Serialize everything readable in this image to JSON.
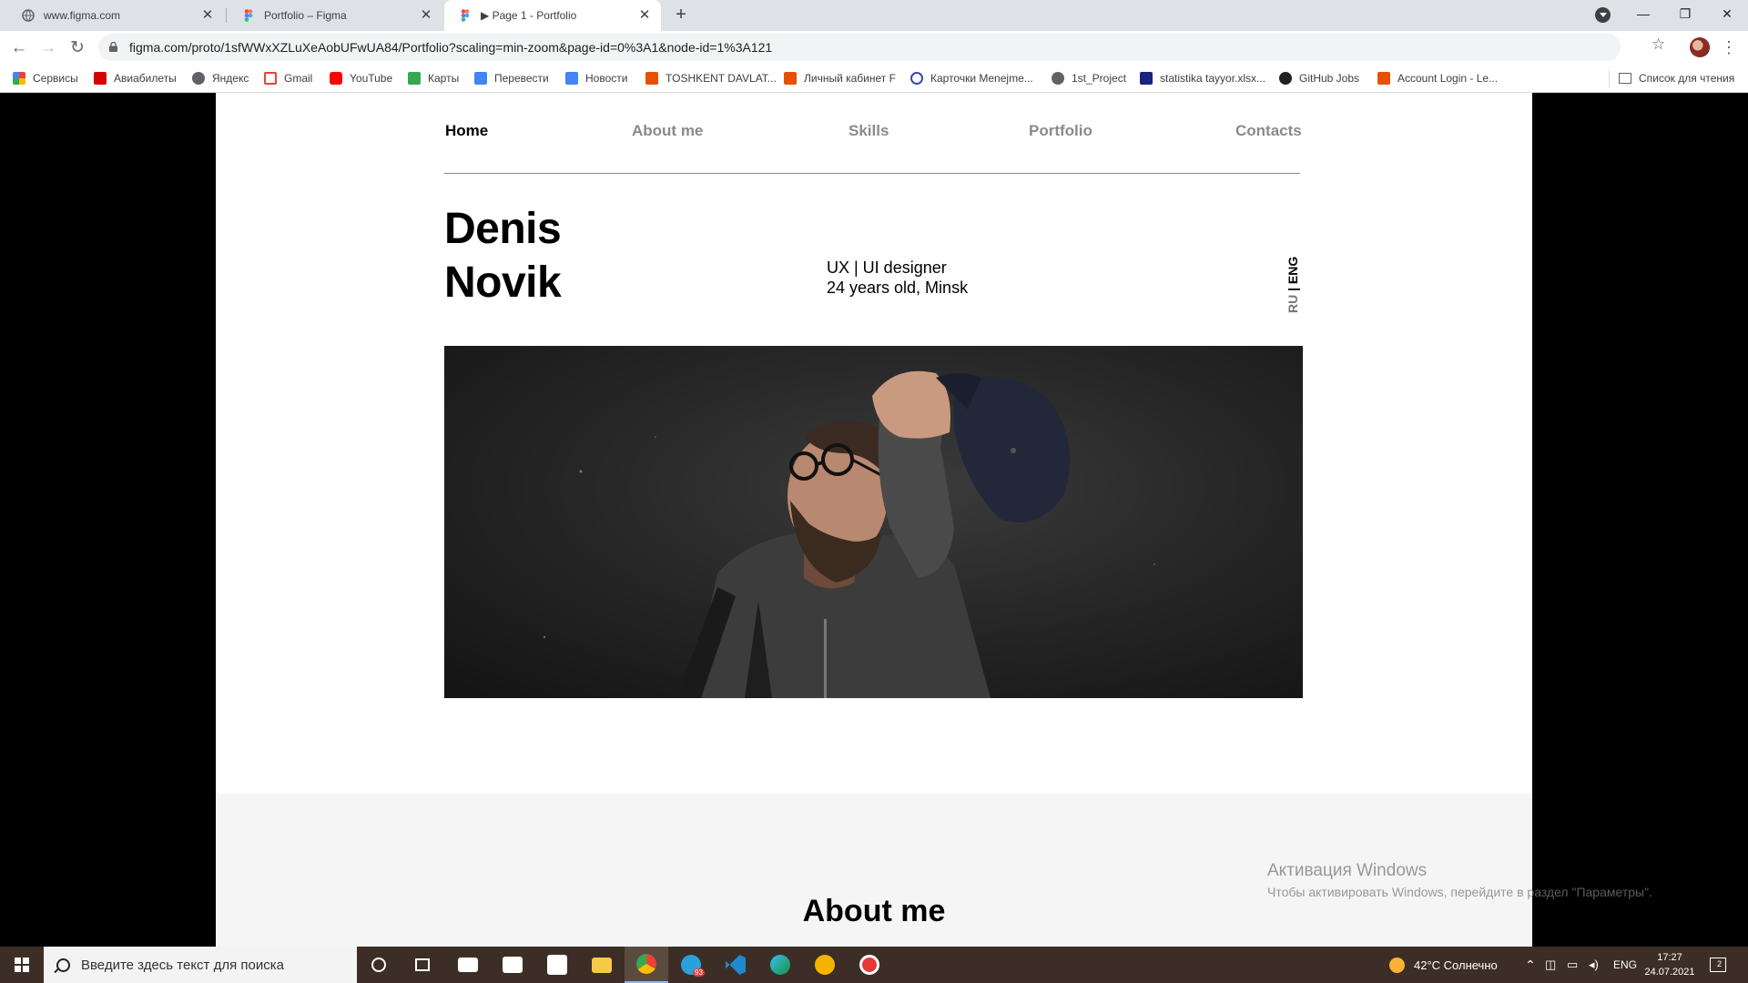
{
  "browser": {
    "tabs": [
      {
        "title": "www.figma.com"
      },
      {
        "title": "Portfolio – Figma"
      },
      {
        "title": "▶ Page 1 - Portfolio"
      }
    ],
    "url": "figma.com/proto/1sfWWxXZLuXeAobUFwUA84/Portfolio?scaling=min-zoom&page-id=0%3A1&node-id=1%3A121",
    "bookmarks": [
      {
        "label": "Сервисы",
        "color": "#ea4335"
      },
      {
        "label": "Авиабилеты",
        "color": "#d50000"
      },
      {
        "label": "Яндекс",
        "color": "#5f6368"
      },
      {
        "label": "Gmail",
        "color": "#ea4335"
      },
      {
        "label": "YouTube",
        "color": "#ff0000"
      },
      {
        "label": "Карты",
        "color": "#34a853"
      },
      {
        "label": "Перевести",
        "color": "#4285f4"
      },
      {
        "label": "Новости",
        "color": "#4285f4"
      },
      {
        "label": "TOSHKENT DAVLAT...",
        "color": "#e65100"
      },
      {
        "label": "Личный кабинет F",
        "color": "#e65100"
      },
      {
        "label": "Карточки Menejme...",
        "color": "#3949ab"
      },
      {
        "label": "1st_Project",
        "color": "#5f6368"
      },
      {
        "label": "statistika tayyor.xlsx...",
        "color": "#1a237e"
      },
      {
        "label": "GitHub Jobs",
        "color": "#202124"
      },
      {
        "label": "Account Login - Le...",
        "color": "#e65100"
      }
    ],
    "reading_list": "Список для чтения"
  },
  "site": {
    "nav": [
      {
        "label": "Home",
        "active": true
      },
      {
        "label": "About me",
        "active": false
      },
      {
        "label": "Skills",
        "active": false
      },
      {
        "label": "Portfolio",
        "active": false
      },
      {
        "label": "Contacts",
        "active": false
      }
    ],
    "hero": {
      "first_name": "Denis",
      "last_name": "Novik",
      "role": "UX | UI designer",
      "details": "24 years old, Minsk"
    },
    "lang": {
      "ru": "RU",
      "sep": " | ",
      "eng": "ENG"
    },
    "about_title": "About me"
  },
  "watermark": {
    "line1": "Активация Windows",
    "line2": "Чтобы активировать Windows, перейдите в раздел \"Параметры\"."
  },
  "taskbar": {
    "search_placeholder": "Введите здесь текст для поиска",
    "weather": "42°C  Солнечно",
    "lang": "ENG",
    "time": "17:27",
    "date": "24.07.2021",
    "notifications": "2",
    "telegram_badge": "93"
  }
}
